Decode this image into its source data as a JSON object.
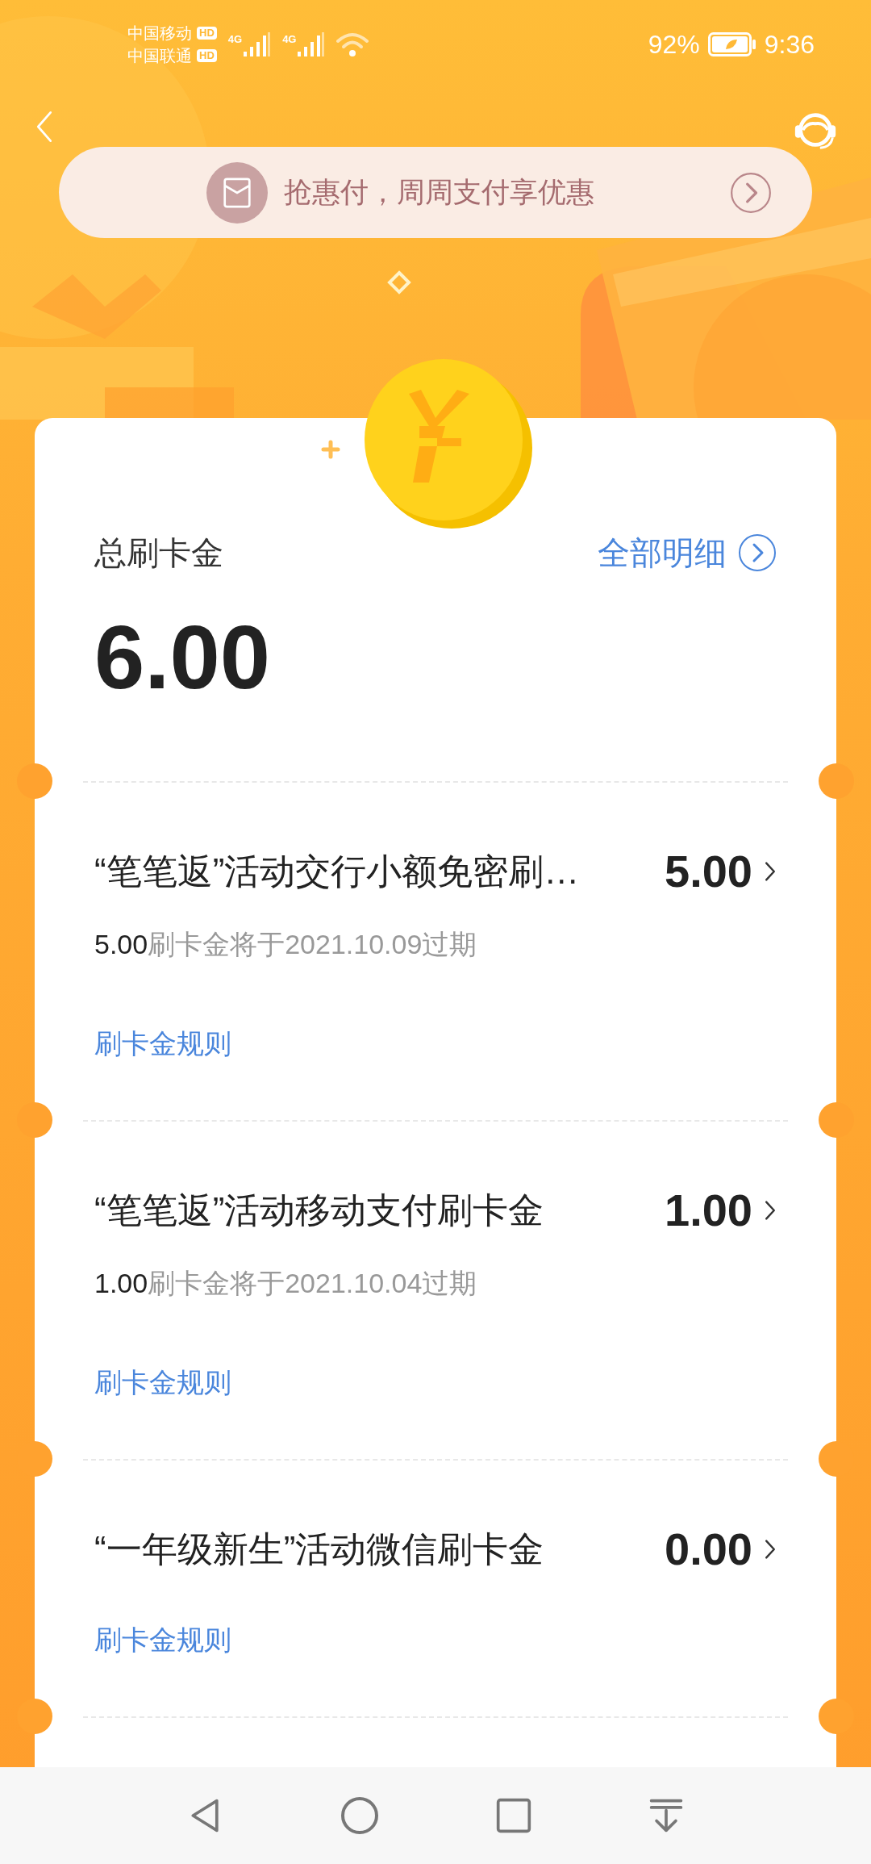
{
  "status_bar": {
    "carriers": [
      {
        "name": "中国移动",
        "badge": "HD"
      },
      {
        "name": "中国联通",
        "badge": "HD"
      }
    ],
    "networks": [
      "4G",
      "4G"
    ],
    "battery": "92%",
    "time": "9:36"
  },
  "banner": {
    "text": "抢惠付，周周支付享优惠"
  },
  "summary": {
    "title": "总刷卡金",
    "link": "全部明细",
    "total": "6.00"
  },
  "items": [
    {
      "title": "“笔笔返”活动交行小额免密刷…",
      "amount": "5.00",
      "expiry": {
        "amount": "5.00",
        "text": "刷卡金将于2021.10.09过期"
      },
      "link": "刷卡金规则"
    },
    {
      "title": "“笔笔返”活动移动支付刷卡金",
      "amount": "1.00",
      "expiry": {
        "amount": "1.00",
        "text": "刷卡金将于2021.10.04过期"
      },
      "link": "刷卡金规则"
    },
    {
      "title": "“一年级新生”活动微信刷卡金",
      "amount": "0.00",
      "link": "刷卡金规则"
    }
  ]
}
